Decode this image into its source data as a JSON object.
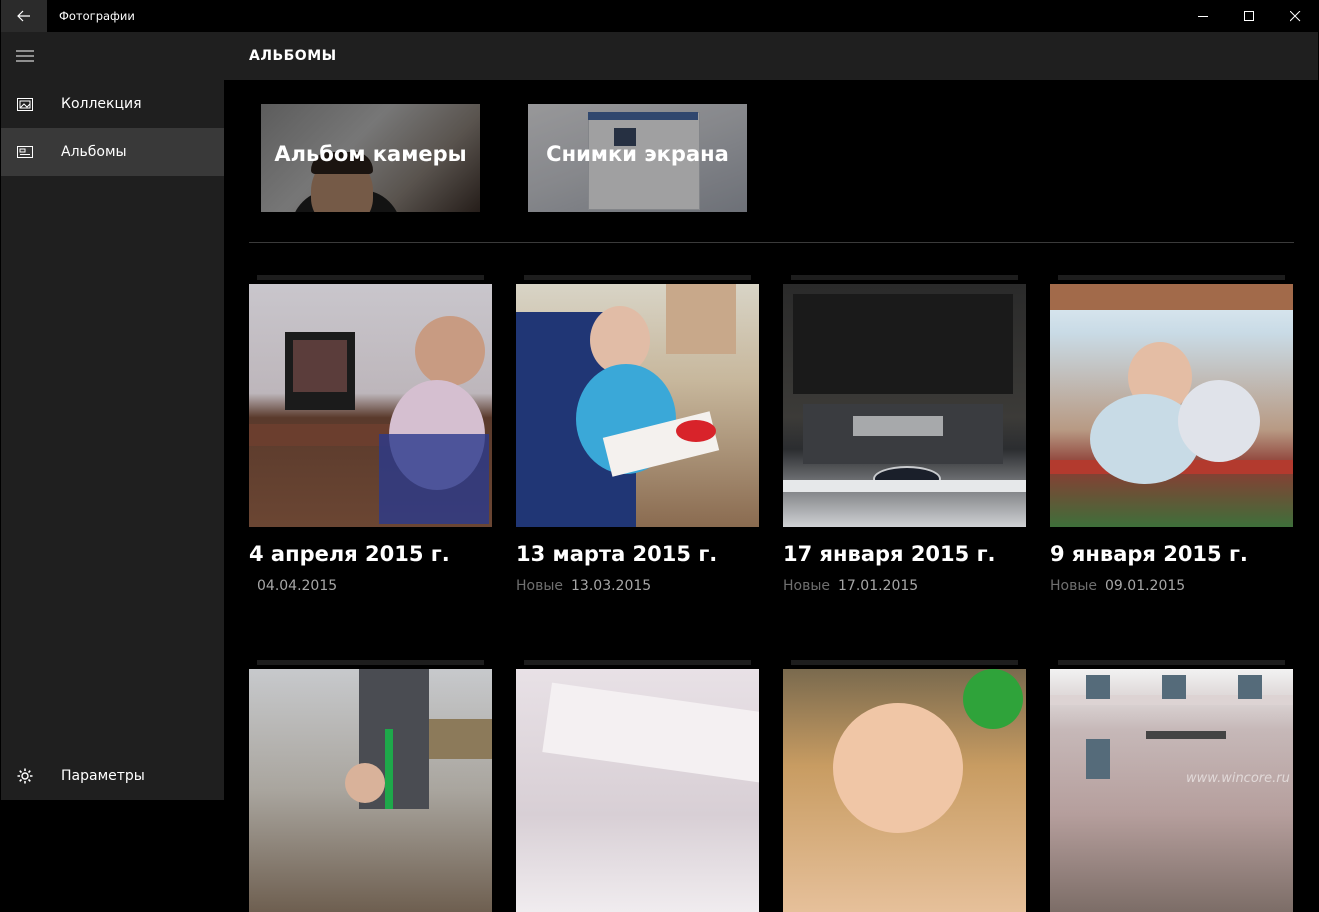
{
  "window": {
    "title": "Фотографии"
  },
  "sidebar": {
    "items": [
      {
        "label": "Коллекция",
        "icon": "collection-icon",
        "selected": false
      },
      {
        "label": "Альбомы",
        "icon": "albums-icon",
        "selected": true
      }
    ],
    "settings_label": "Параметры"
  },
  "header": {
    "title": "АЛЬБОМЫ"
  },
  "albums": [
    {
      "label": "Альбом камеры"
    },
    {
      "label": "Снимки экрана"
    }
  ],
  "events": [
    {
      "title": "4 апреля 2015 г.",
      "date": "04.04.2015",
      "new_label": ""
    },
    {
      "title": "13 марта 2015 г.",
      "date": "13.03.2015",
      "new_label": "Новые"
    },
    {
      "title": "17 января 2015 г.",
      "date": "17.01.2015",
      "new_label": "Новые"
    },
    {
      "title": "9 января 2015 г.",
      "date": "09.01.2015",
      "new_label": "Новые"
    }
  ],
  "watermark": "www.wincore.ru",
  "colors": {
    "background": "#000000",
    "panel": "#1f1f1f",
    "selected": "#393939",
    "muted_text": "#a6a6a6"
  }
}
